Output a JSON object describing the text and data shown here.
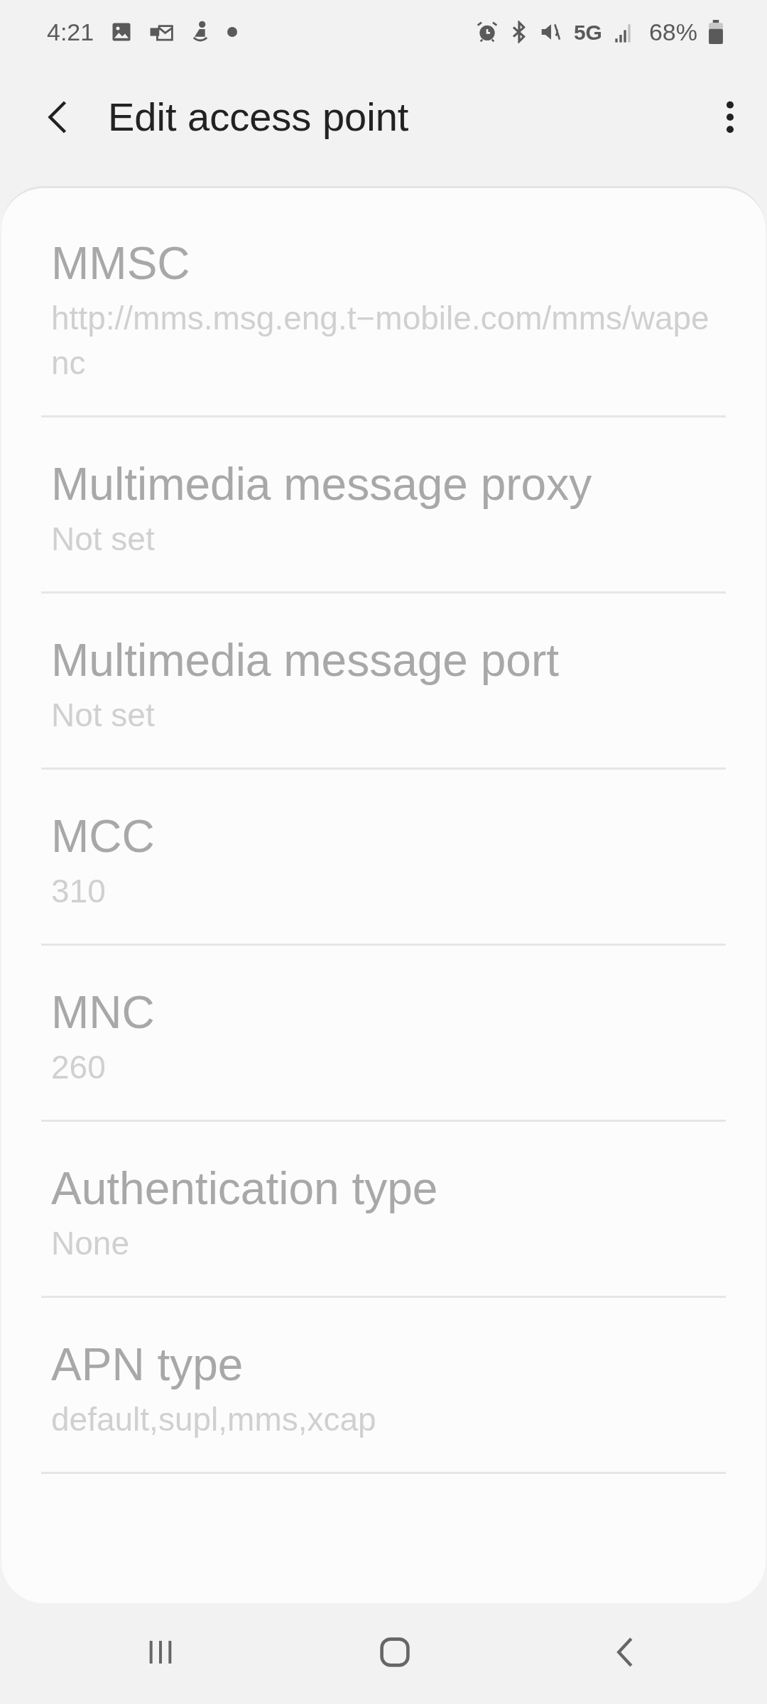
{
  "status_bar": {
    "time": "4:21",
    "network": "5G",
    "battery": "68%"
  },
  "header": {
    "title": "Edit access point"
  },
  "settings": [
    {
      "title": "MMSC",
      "value": "http://mms.msg.eng.t−mobile.com/mms/wapenc",
      "disabled": true
    },
    {
      "title": "Multimedia message proxy",
      "value": "Not set",
      "disabled": true
    },
    {
      "title": "Multimedia message port",
      "value": "Not set",
      "disabled": true
    },
    {
      "title": "MCC",
      "value": "310",
      "disabled": true
    },
    {
      "title": "MNC",
      "value": "260",
      "disabled": true
    },
    {
      "title": "Authentication type",
      "value": "None",
      "disabled": true
    },
    {
      "title": "APN type",
      "value": "default,supl,mms,xcap",
      "disabled": true
    }
  ]
}
